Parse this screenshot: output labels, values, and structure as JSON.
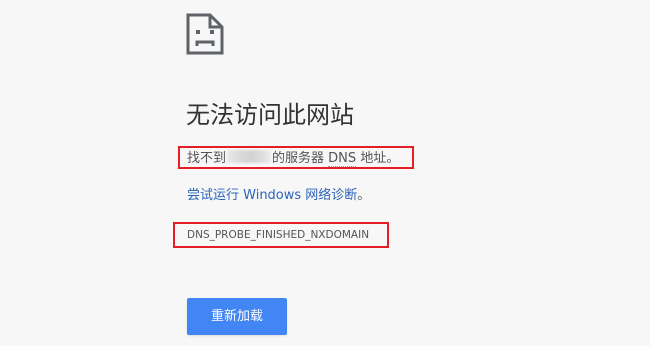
{
  "page": {
    "icon": "sad-page-icon",
    "title": "无法访问此网站",
    "host_prefix": "找不到",
    "host_suffix": "的服务器",
    "dns_word": "DNS",
    "host_end": "地址。",
    "diagnose_link": "尝试运行 Windows 网络诊断",
    "diagnose_end": "。",
    "error_code": "DNS_PROBE_FINISHED_NXDOMAIN",
    "reload_label": "重新加载"
  },
  "colors": {
    "background": "#f7f7f7",
    "link": "#2c64b8",
    "button": "#4285f4",
    "annotation": "#e31e24"
  }
}
